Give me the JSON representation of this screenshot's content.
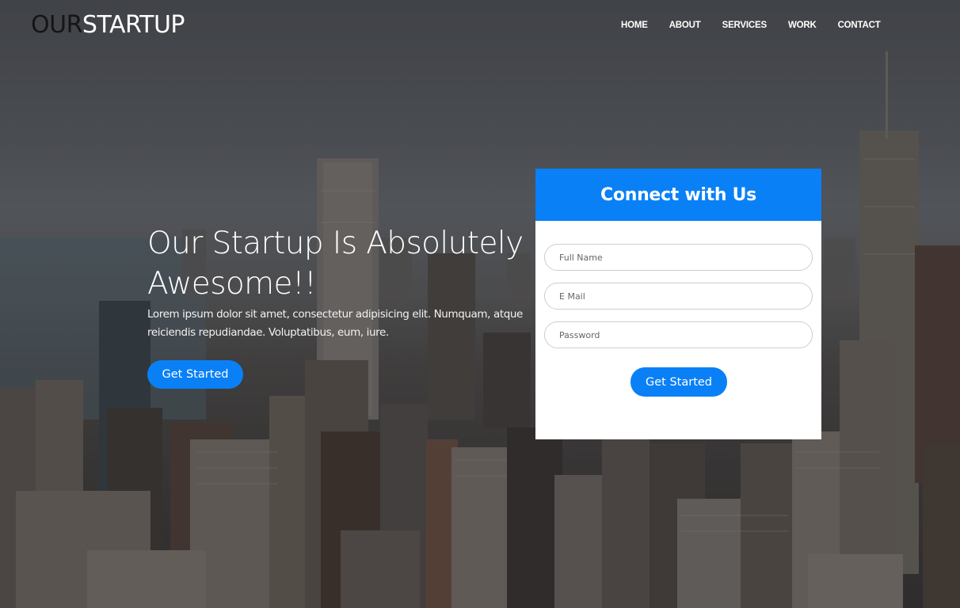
{
  "brand": {
    "part_dark": "OUR",
    "part_light": "STARTUP"
  },
  "nav": {
    "items": [
      "HOME",
      "ABOUT",
      "SERVICES",
      "WORK",
      "CONTACT"
    ]
  },
  "hero": {
    "title": "Our Startup Is Absolutely Awesome!!",
    "text": "Lorem ipsum dolor sit amet, consectetur adipisicing elit. Numquam, atque reiciendis repudiandae. Voluptatibus, eum, iure.",
    "button_label": "Get Started"
  },
  "form": {
    "title": "Connect with Us",
    "fields": {
      "full_name": {
        "placeholder": "Full Name",
        "value": ""
      },
      "email": {
        "placeholder": "E Mail",
        "value": ""
      },
      "password": {
        "placeholder": "Password",
        "value": ""
      }
    },
    "button_label": "Get Started"
  },
  "colors": {
    "accent": "#0a80f6",
    "card_bg": "#ffffff",
    "brand_dark": "#151515"
  }
}
